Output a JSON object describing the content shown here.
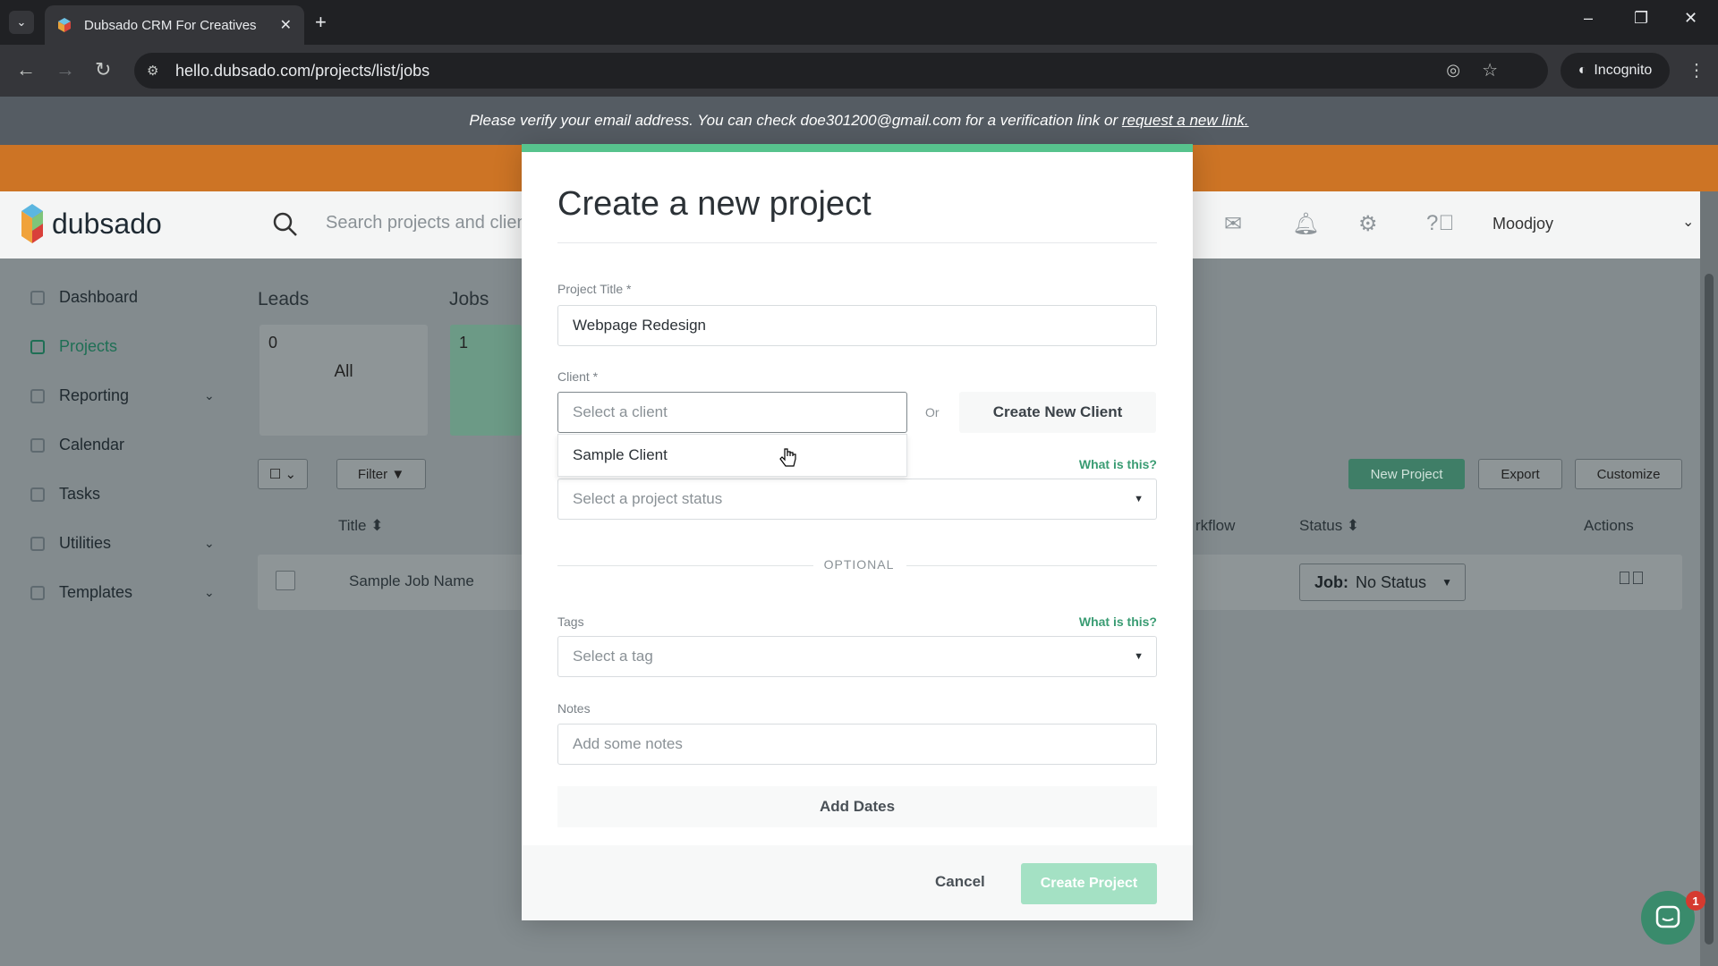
{
  "browser": {
    "tab_title": "Dubsado CRM For Creatives",
    "url": "hello.dubsado.com/projects/list/jobs",
    "incognito_label": "Incognito"
  },
  "banner": {
    "verify_text": "Please verify your email address. You can check doe301200@gmail.com for a verification link or",
    "verify_link": "request a new link."
  },
  "header": {
    "logo_text": "dubsado",
    "search_placeholder": "Search projects and client",
    "user_name": "Moodjoy"
  },
  "sidebar": {
    "items": [
      {
        "label": "Dashboard"
      },
      {
        "label": "Projects"
      },
      {
        "label": "Reporting"
      },
      {
        "label": "Calendar"
      },
      {
        "label": "Tasks"
      },
      {
        "label": "Utilities"
      },
      {
        "label": "Templates"
      }
    ]
  },
  "pipeline": {
    "leads_label": "Leads",
    "jobs_label": "Jobs",
    "leads_count": "0",
    "leads_card_label": "All",
    "jobs_count": "1"
  },
  "toolbar": {
    "filter_label": "Filter",
    "new_project_label": "New Project",
    "export_label": "Export",
    "customize_label": "Customize"
  },
  "table": {
    "columns": {
      "title": "Title ⬍",
      "workflow": "rkflow",
      "status": "Status ⬍",
      "actions": "Actions"
    },
    "rows": [
      {
        "title": "Sample Job Name",
        "status_prefix": "Job:",
        "status_value": "No Status"
      }
    ]
  },
  "chat": {
    "badge_count": "1"
  },
  "modal": {
    "title": "Create a new project",
    "project_title_label": "Project Title *",
    "project_title_value": "Webpage Redesign",
    "client_label": "Client *",
    "client_placeholder": "Select a client",
    "or_text": "Or",
    "create_client_label": "Create New Client",
    "client_options": [
      "Sample Client"
    ],
    "what_is_this": "What is this?",
    "status_placeholder": "Select a project status",
    "optional_label": "OPTIONAL",
    "tags_label": "Tags",
    "tags_placeholder": "Select a tag",
    "notes_label": "Notes",
    "notes_placeholder": "Add some notes",
    "add_dates_label": "Add Dates",
    "cancel_label": "Cancel",
    "create_label": "Create Project"
  },
  "colors": {
    "brand_green": "#57c38d",
    "banner_orange": "#e07f27"
  }
}
